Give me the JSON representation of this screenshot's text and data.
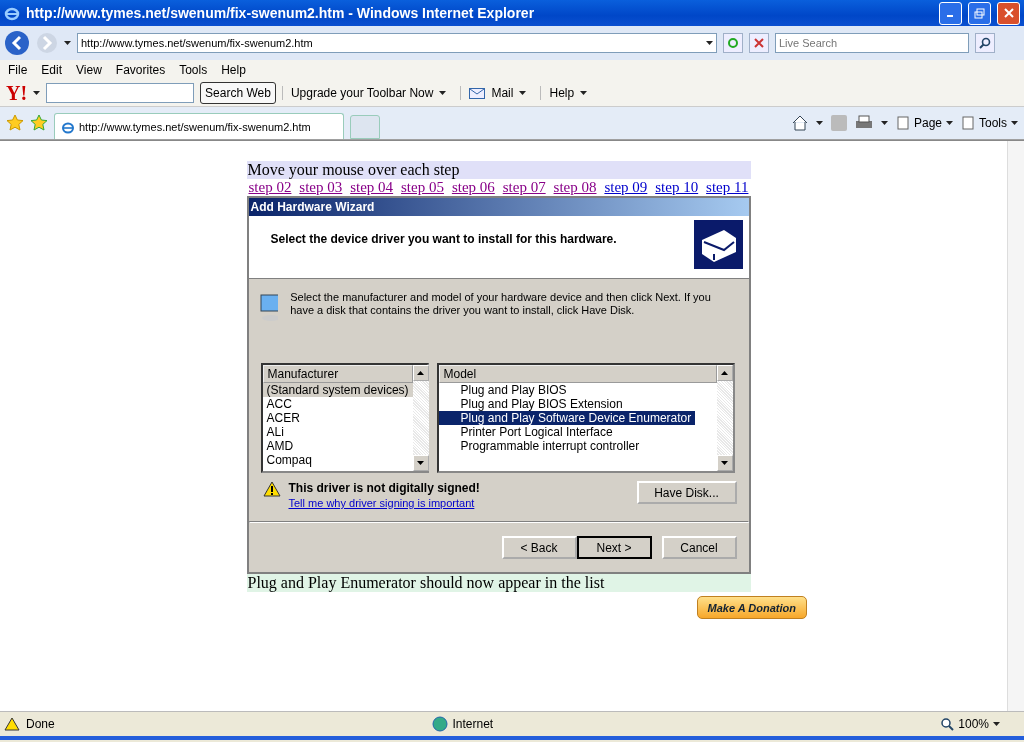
{
  "window": {
    "title": "http://www.tymes.net/swenum/fix-swenum2.htm - Windows Internet Explorer"
  },
  "address_bar": {
    "url": "http://www.tymes.net/swenum/fix-swenum2.htm"
  },
  "search": {
    "placeholder": "Live Search"
  },
  "menu": [
    "File",
    "Edit",
    "View",
    "Favorites",
    "Tools",
    "Help"
  ],
  "yahoo_toolbar": {
    "logo": "Y!",
    "search_button": "Search Web",
    "items": [
      "Upgrade your Toolbar Now",
      "Mail",
      "Help"
    ]
  },
  "tabs": [
    {
      "label": "http://www.tymes.net/swenum/fix-swenum2.htm",
      "selected": true
    }
  ],
  "command_bar": [
    "Page",
    "Tools"
  ],
  "page": {
    "heading": "Move your mouse over each step",
    "steps": [
      {
        "label": "step 02",
        "visited": true
      },
      {
        "label": "step 03",
        "visited": true
      },
      {
        "label": "step 04",
        "visited": true
      },
      {
        "label": "step 05",
        "visited": true
      },
      {
        "label": "step 06",
        "visited": true
      },
      {
        "label": "step 07",
        "visited": true
      },
      {
        "label": "step 08",
        "visited": true
      },
      {
        "label": "step 09",
        "visited": false
      },
      {
        "label": "step 10",
        "visited": false
      },
      {
        "label": "step 11",
        "visited": false
      }
    ],
    "wizard": {
      "title": "Add Hardware Wizard",
      "header": "Select the device driver you want to install for this hardware.",
      "instruction": "Select the manufacturer and model of your hardware device and then click Next. If you have a disk that contains the driver you want to install, click Have Disk.",
      "manufacturer": {
        "header": "Manufacturer",
        "items": [
          {
            "label": "(Standard system devices)",
            "selected": true
          },
          {
            "label": "ACC",
            "selected": false
          },
          {
            "label": "ACER",
            "selected": false
          },
          {
            "label": "ALi",
            "selected": false
          },
          {
            "label": "AMD",
            "selected": false
          },
          {
            "label": "Compaq",
            "selected": false
          }
        ]
      },
      "model": {
        "header": "Model",
        "items": [
          {
            "label": "Plug and Play BIOS",
            "selected": false
          },
          {
            "label": "Plug and Play BIOS Extension",
            "selected": false
          },
          {
            "label": "Plug and Play Software Device Enumerator",
            "selected": true
          },
          {
            "label": "Printer Port Logical Interface",
            "selected": false
          },
          {
            "label": "Programmable interrupt controller",
            "selected": false
          }
        ]
      },
      "warning": "This driver is not digitally signed!",
      "link": "Tell me why driver signing is important",
      "have_disk_button": "Have Disk...",
      "buttons": [
        {
          "label": "< Back",
          "default": false
        },
        {
          "label": "Next >",
          "default": true
        },
        {
          "label": "Cancel",
          "default": false
        }
      ]
    },
    "caption": "Plug and Play Enumerator should now appear in the list",
    "donate_button": "Make A Donation"
  },
  "status_bar": {
    "text": "Done",
    "zone": "Internet",
    "zoom": "100%"
  }
}
